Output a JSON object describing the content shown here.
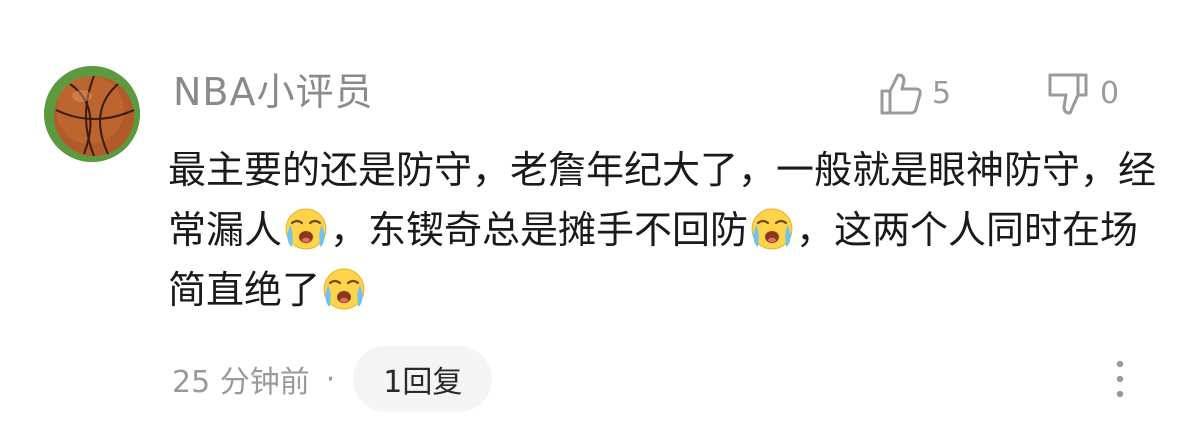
{
  "comment": {
    "username": "NBA小评员",
    "avatar_icon": "basketball-avatar",
    "like_icon": "thumbs-up-icon",
    "likes": "5",
    "dislike_icon": "thumbs-down-icon",
    "dislikes": "0",
    "text_segments": [
      "最主要的还是防守，老詹年纪大了，一般就是眼神防守，经常漏人",
      "，东锲奇总是摊手不回防",
      "，这两个人同时在场简直绝了"
    ],
    "emoji_name": "loudly-crying-face",
    "timestamp": "25 分钟前",
    "separator": "·",
    "reply_label": "1回复",
    "more_icon": "more-vertical-icon"
  }
}
